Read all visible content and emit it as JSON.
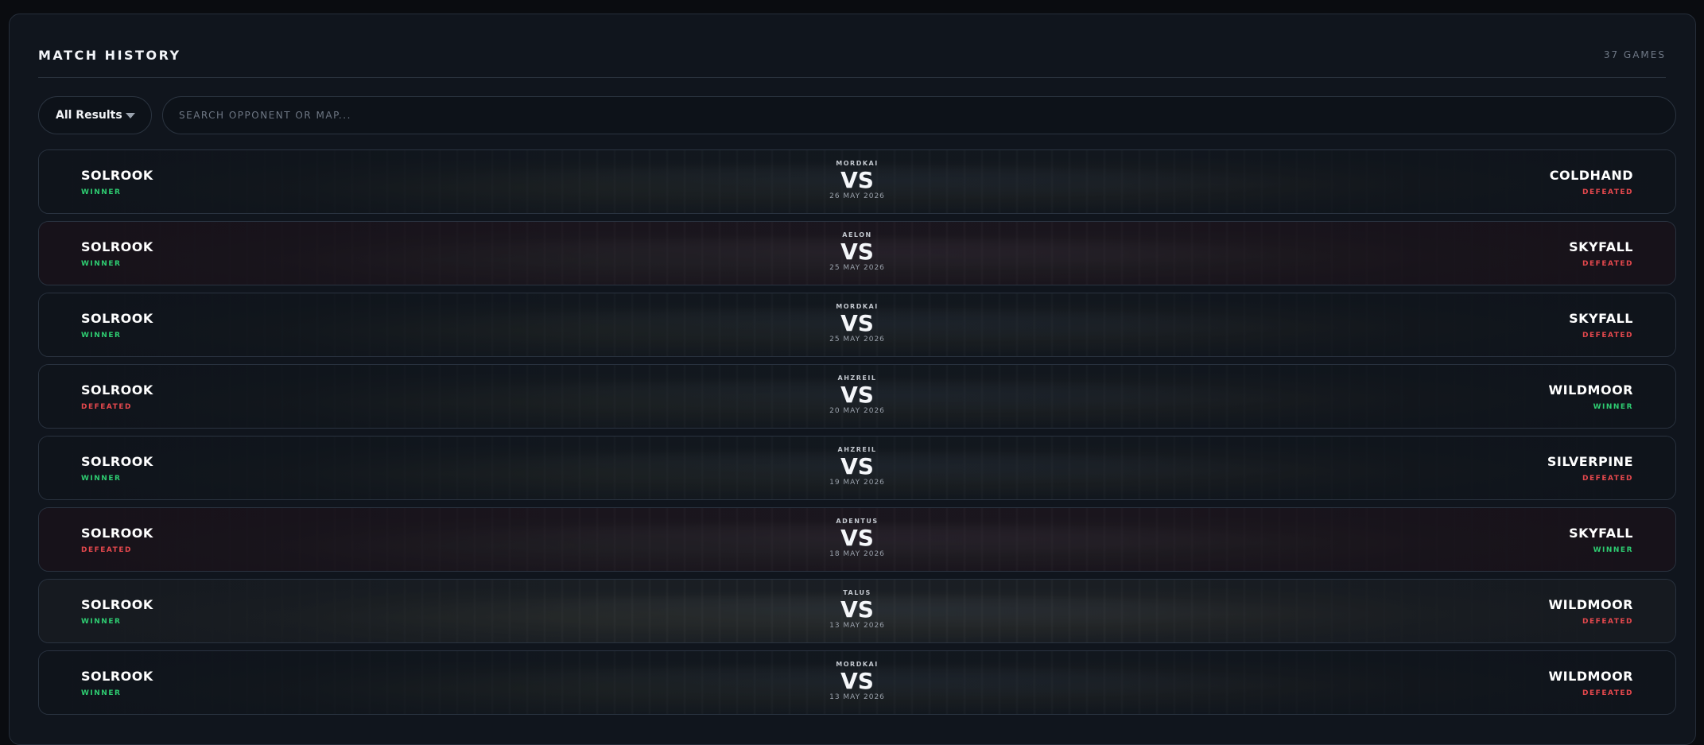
{
  "header": {
    "title": "MATCH HISTORY",
    "count": "37 GAMES"
  },
  "filter": {
    "label": "All Results"
  },
  "search": {
    "placeholder": "SEARCH OPPONENT OR MAP..."
  },
  "matches": [
    {
      "player": "SOLROOK",
      "player_result": "WINNER",
      "map": "MORDKAI",
      "date": "26 MAY 2026",
      "opponent": "COLDHAND",
      "opponent_result": "DEFEATED"
    },
    {
      "player": "SOLROOK",
      "player_result": "WINNER",
      "map": "AELON",
      "date": "25 MAY 2026",
      "opponent": "SKYFALL",
      "opponent_result": "DEFEATED"
    },
    {
      "player": "SOLROOK",
      "player_result": "WINNER",
      "map": "MORDKAI",
      "date": "25 MAY 2026",
      "opponent": "SKYFALL",
      "opponent_result": "DEFEATED"
    },
    {
      "player": "SOLROOK",
      "player_result": "DEFEATED",
      "map": "AHZREIL",
      "date": "20 MAY 2026",
      "opponent": "WILDMOOR",
      "opponent_result": "WINNER"
    },
    {
      "player": "SOLROOK",
      "player_result": "WINNER",
      "map": "AHZREIL",
      "date": "19 MAY 2026",
      "opponent": "SILVERPINE",
      "opponent_result": "DEFEATED"
    },
    {
      "player": "SOLROOK",
      "player_result": "DEFEATED",
      "map": "ADENTUS",
      "date": "18 MAY 2026",
      "opponent": "SKYFALL",
      "opponent_result": "WINNER"
    },
    {
      "player": "SOLROOK",
      "player_result": "WINNER",
      "map": "TALUS",
      "date": "13 MAY 2026",
      "opponent": "WILDMOOR",
      "opponent_result": "DEFEATED"
    },
    {
      "player": "SOLROOK",
      "player_result": "WINNER",
      "map": "MORDKAI",
      "date": "13 MAY 2026",
      "opponent": "WILDMOOR",
      "opponent_result": "DEFEATED"
    }
  ],
  "vs_label": "VS",
  "colors": {
    "winner": "#2ecc71",
    "defeated": "#e5484d",
    "background": "#10151d"
  }
}
